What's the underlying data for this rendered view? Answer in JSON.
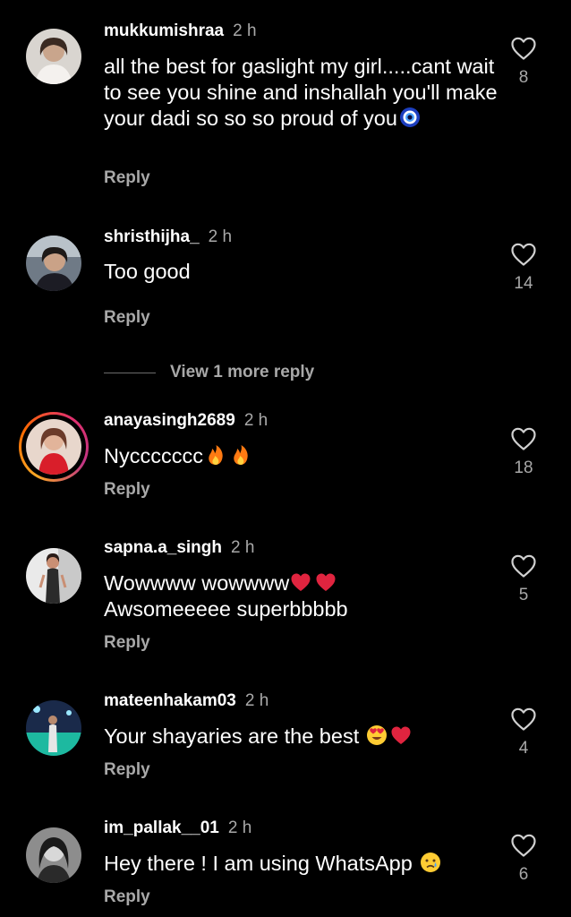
{
  "colors": {
    "background": "#000000",
    "text_primary": "#ffffff",
    "text_secondary": "#a8a8a8",
    "heart_emoji": "#e0243f",
    "story_ring": "#ff6a00"
  },
  "like_icon": "heart-outline-icon",
  "comments": [
    {
      "username": "mukkumishraa",
      "time": "2 h",
      "text": "all the best for gaslight my girl.....cant wait to see you shine and inshallah you'll make your dadi so so so proud of you",
      "emojis": [
        "nazar-amulet-emoji"
      ],
      "reply": "Reply",
      "likes": "8",
      "story": false
    },
    {
      "username": "shristhijha_",
      "time": "2 h",
      "text": "Too good",
      "emojis": [],
      "reply": "Reply",
      "likes": "14",
      "story": false
    },
    {
      "username": "anayasingh2689",
      "time": "2 h",
      "text": "Nyccccccc",
      "emojis": [
        "fire-emoji",
        "fire-emoji"
      ],
      "reply": "Reply",
      "likes": "18",
      "story": true
    },
    {
      "username": "sapna.a_singh",
      "time": "2 h",
      "text_line1": "Wowwww wowwww",
      "text_line2": "Awsomeeeee superbbbbb",
      "emojis": [
        "red-heart-emoji",
        "red-heart-emoji"
      ],
      "reply": "Reply",
      "likes": "5",
      "story": false
    },
    {
      "username": "mateenhakam03",
      "time": "2 h",
      "text": "Your shayaries are the best",
      "emojis": [
        "heart-eyes-emoji",
        "red-heart-emoji"
      ],
      "reply": "Reply",
      "likes": "4",
      "story": false
    },
    {
      "username": "im_pallak__01",
      "time": "2 h",
      "text": "Hey there ! I am using WhatsApp",
      "emojis": [
        "crying-face-emoji"
      ],
      "reply": "Reply",
      "likes": "6",
      "story": false
    }
  ],
  "view_more_replies": "View 1 more reply"
}
